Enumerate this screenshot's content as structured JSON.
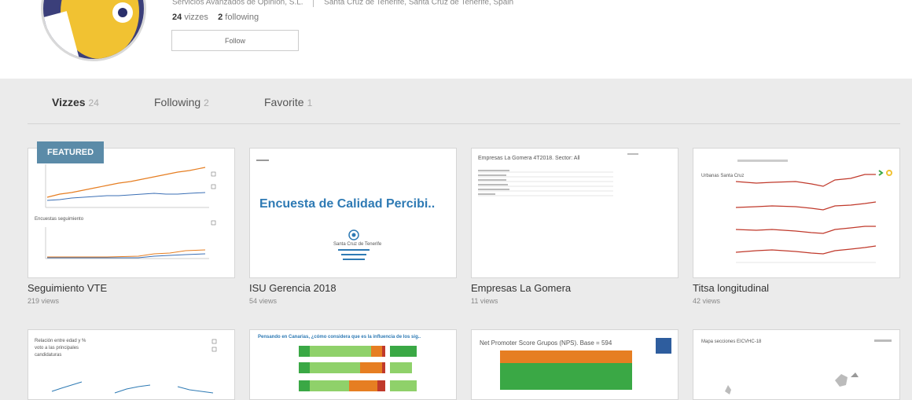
{
  "profile": {
    "company": "Servicios Avanzados de Opinión, S.L.",
    "location": "Santa Cruz de Tenerife, Santa Cruz de Tenerife, Spain",
    "vizzes_count": "24",
    "vizzes_label": "vizzes",
    "following_count": "2",
    "following_label": "following",
    "follow_label": "Follow"
  },
  "tabs": [
    {
      "label": "Vizzes",
      "count": "24"
    },
    {
      "label": "Following",
      "count": "2"
    },
    {
      "label": "Favorite",
      "count": "1"
    }
  ],
  "cards": [
    {
      "title": "Seguimiento VTE",
      "views": "219 views",
      "badge": "FEATURED",
      "thumb_label": "Encuestas seguimiento"
    },
    {
      "title": "ISU Gerencia 2018",
      "views": "54 views",
      "thumb_label": "Encuesta de Calidad Percibi..",
      "thumb_sub": "Santa Cruz de Tenerife"
    },
    {
      "title": "Empresas La Gomera",
      "views": "11 views",
      "thumb_label": "Empresas La Gomera 4T2018. Sector: All"
    },
    {
      "title": "Titsa longitudinal",
      "views": "42 views",
      "thumb_label": "Urbanas Santa Cruz"
    }
  ],
  "cards_row2": [
    {
      "thumb_label": "Relación entre edad y % voto a las principales candidaturas"
    },
    {
      "thumb_label": "Pensando en Canarias, ¿cómo considera que es la influencia de los sig.."
    },
    {
      "thumb_label": "Net Promoter Score Grupos (NPS). Base = 594"
    },
    {
      "thumb_label": "Mapa secciones EICVHC-18"
    }
  ],
  "colors": {
    "accent": "#5b8ba8",
    "brand_yellow": "#f1c232",
    "brand_navy": "#3b3f7a",
    "title_blue": "#2e7ab4",
    "green": "#3aa845",
    "orange": "#e67e22"
  }
}
